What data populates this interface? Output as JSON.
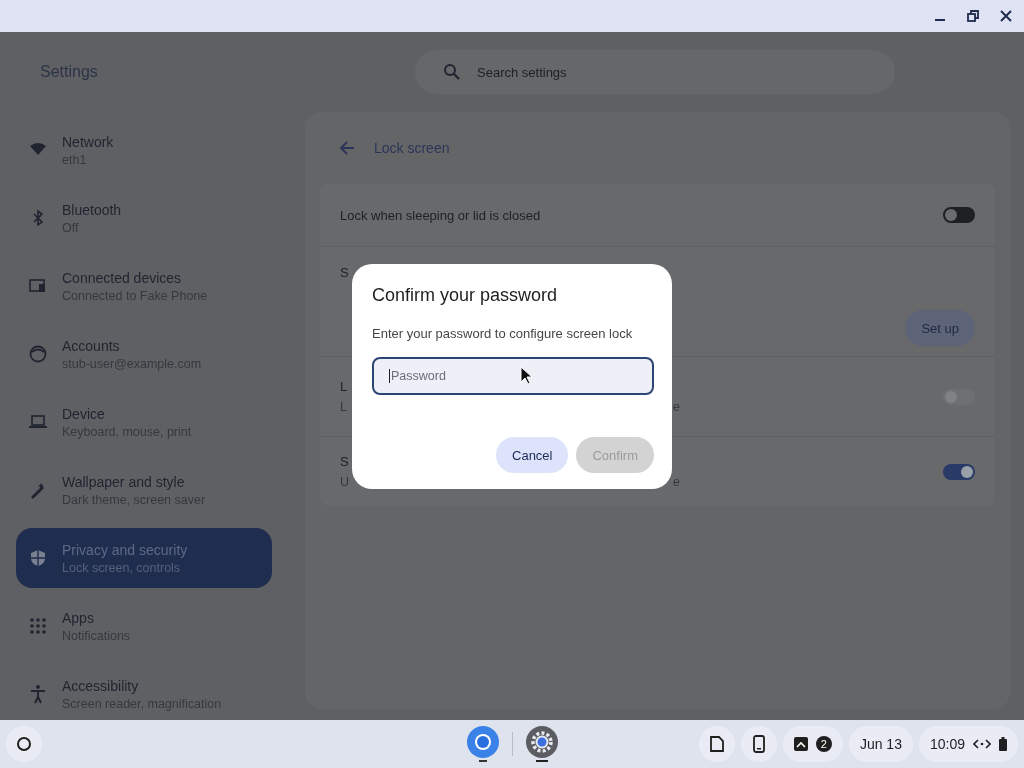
{
  "app_title": "Settings",
  "search": {
    "placeholder": "Search settings"
  },
  "sidebar": {
    "items": [
      {
        "label": "Network",
        "sublabel": "eth1",
        "selected": false
      },
      {
        "label": "Bluetooth",
        "sublabel": "Off",
        "selected": false
      },
      {
        "label": "Connected devices",
        "sublabel": "Connected to Fake Phone",
        "selected": false
      },
      {
        "label": "Accounts",
        "sublabel": "stub-user@example.com",
        "selected": false
      },
      {
        "label": "Device",
        "sublabel": "Keyboard, mouse, print",
        "selected": false
      },
      {
        "label": "Wallpaper and style",
        "sublabel": "Dark theme, screen saver",
        "selected": false
      },
      {
        "label": "Privacy and security",
        "sublabel": "Lock screen, controls",
        "selected": true
      },
      {
        "label": "Apps",
        "sublabel": "Notifications",
        "selected": false
      },
      {
        "label": "Accessibility",
        "sublabel": "Screen reader, magnification",
        "selected": false
      }
    ]
  },
  "page": {
    "title": "Lock screen",
    "rows": [
      {
        "kind": "toggle",
        "title": "Lock when sleeping or lid is closed",
        "on": false,
        "disabled": false
      },
      {
        "kind": "button",
        "title": "S",
        "button": "Set up"
      },
      {
        "kind": "toggle",
        "title": "L",
        "subtitle": "L",
        "trailing": "e",
        "on": false,
        "disabled": true
      },
      {
        "kind": "toggle",
        "title": "S",
        "subtitle": "U",
        "trailing": "e",
        "on": true,
        "disabled": false
      }
    ]
  },
  "dialog": {
    "title": "Confirm your password",
    "message": "Enter your password to configure screen lock",
    "password": {
      "placeholder": "Password"
    },
    "buttons": [
      {
        "label": "Cancel",
        "disabled": false
      },
      {
        "label": "Confirm",
        "disabled": true
      }
    ]
  },
  "shelf": {
    "badge": "2",
    "date": "Jun 13",
    "time": "10:09"
  }
}
